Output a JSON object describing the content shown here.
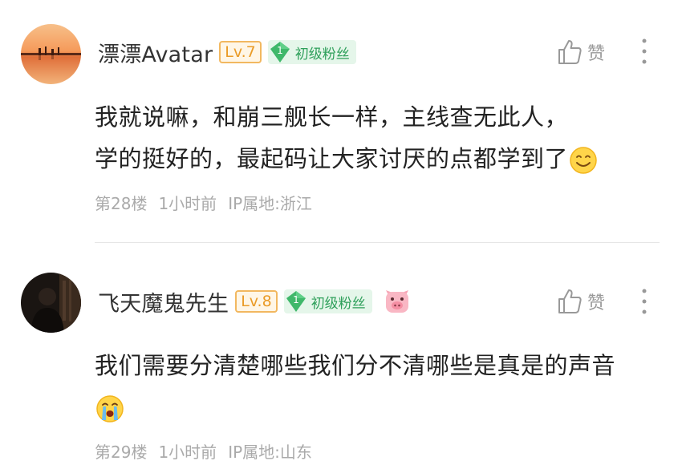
{
  "comments": [
    {
      "username": "漂漂Avatar",
      "level": "Lv.7",
      "fan_level": "1",
      "fan_label": "初级粉丝",
      "like_label": "赞",
      "content_lines": [
        "我就说嘛，和崩三舰长一样，主线查无此人，",
        "学的挺好的，最起码让大家讨厌的点都学到了"
      ],
      "content_emoji": "smile-emoji",
      "floor": "第28楼",
      "time": "1小时前",
      "ip": "IP属地:浙江"
    },
    {
      "username": "飞天魔鬼先生",
      "level": "Lv.8",
      "fan_level": "1",
      "fan_label": "初级粉丝",
      "like_label": "赞",
      "content_lines": [
        "我们需要分清楚哪些我们分不清哪些是真是的声音"
      ],
      "content_emoji": "crying-emoji",
      "floor": "第29楼",
      "time": "1小时前",
      "ip": "IP属地:山东"
    }
  ],
  "colors": {
    "level_badge": "#ea9b27",
    "fan_badge": "#2fa05b",
    "meta_text": "#aaaaaa"
  }
}
